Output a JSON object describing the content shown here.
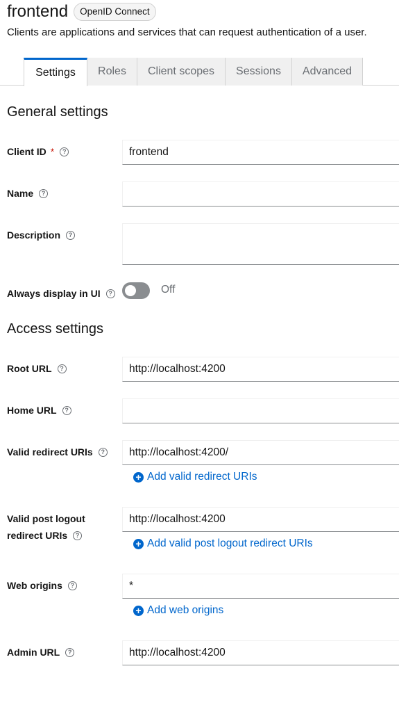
{
  "header": {
    "client_name": "frontend",
    "protocol_badge": "OpenID Connect",
    "description": "Clients are applications and services that can request authentication of a user."
  },
  "tabs": [
    {
      "label": "Settings",
      "active": true
    },
    {
      "label": "Roles"
    },
    {
      "label": "Client scopes"
    },
    {
      "label": "Sessions"
    },
    {
      "label": "Advanced"
    }
  ],
  "general": {
    "title": "General settings",
    "client_id": {
      "label": "Client ID",
      "required_mark": "*",
      "value": "frontend"
    },
    "name": {
      "label": "Name",
      "value": ""
    },
    "description": {
      "label": "Description",
      "value": ""
    },
    "always_display": {
      "label": "Always display in UI",
      "state_text": "Off"
    }
  },
  "access": {
    "title": "Access settings",
    "root_url": {
      "label": "Root URL",
      "value": "http://localhost:4200"
    },
    "home_url": {
      "label": "Home URL",
      "value": ""
    },
    "valid_redirect": {
      "label": "Valid redirect URIs",
      "value": "http://localhost:4200/",
      "add_label": "Add valid redirect URIs"
    },
    "valid_post_logout": {
      "label_line1": "Valid post logout",
      "label_line2": "redirect URIs",
      "value": "http://localhost:4200",
      "add_label": "Add valid post logout redirect URIs"
    },
    "web_origins": {
      "label": "Web origins",
      "value": "*",
      "add_label": "Add web origins"
    },
    "admin_url": {
      "label": "Admin URL",
      "value": "http://localhost:4200"
    }
  },
  "icons": {
    "help": "?",
    "plus": "+"
  },
  "colors": {
    "accent": "#0066cc",
    "required": "#c9190b",
    "toggle_off": "#8a8d90"
  }
}
